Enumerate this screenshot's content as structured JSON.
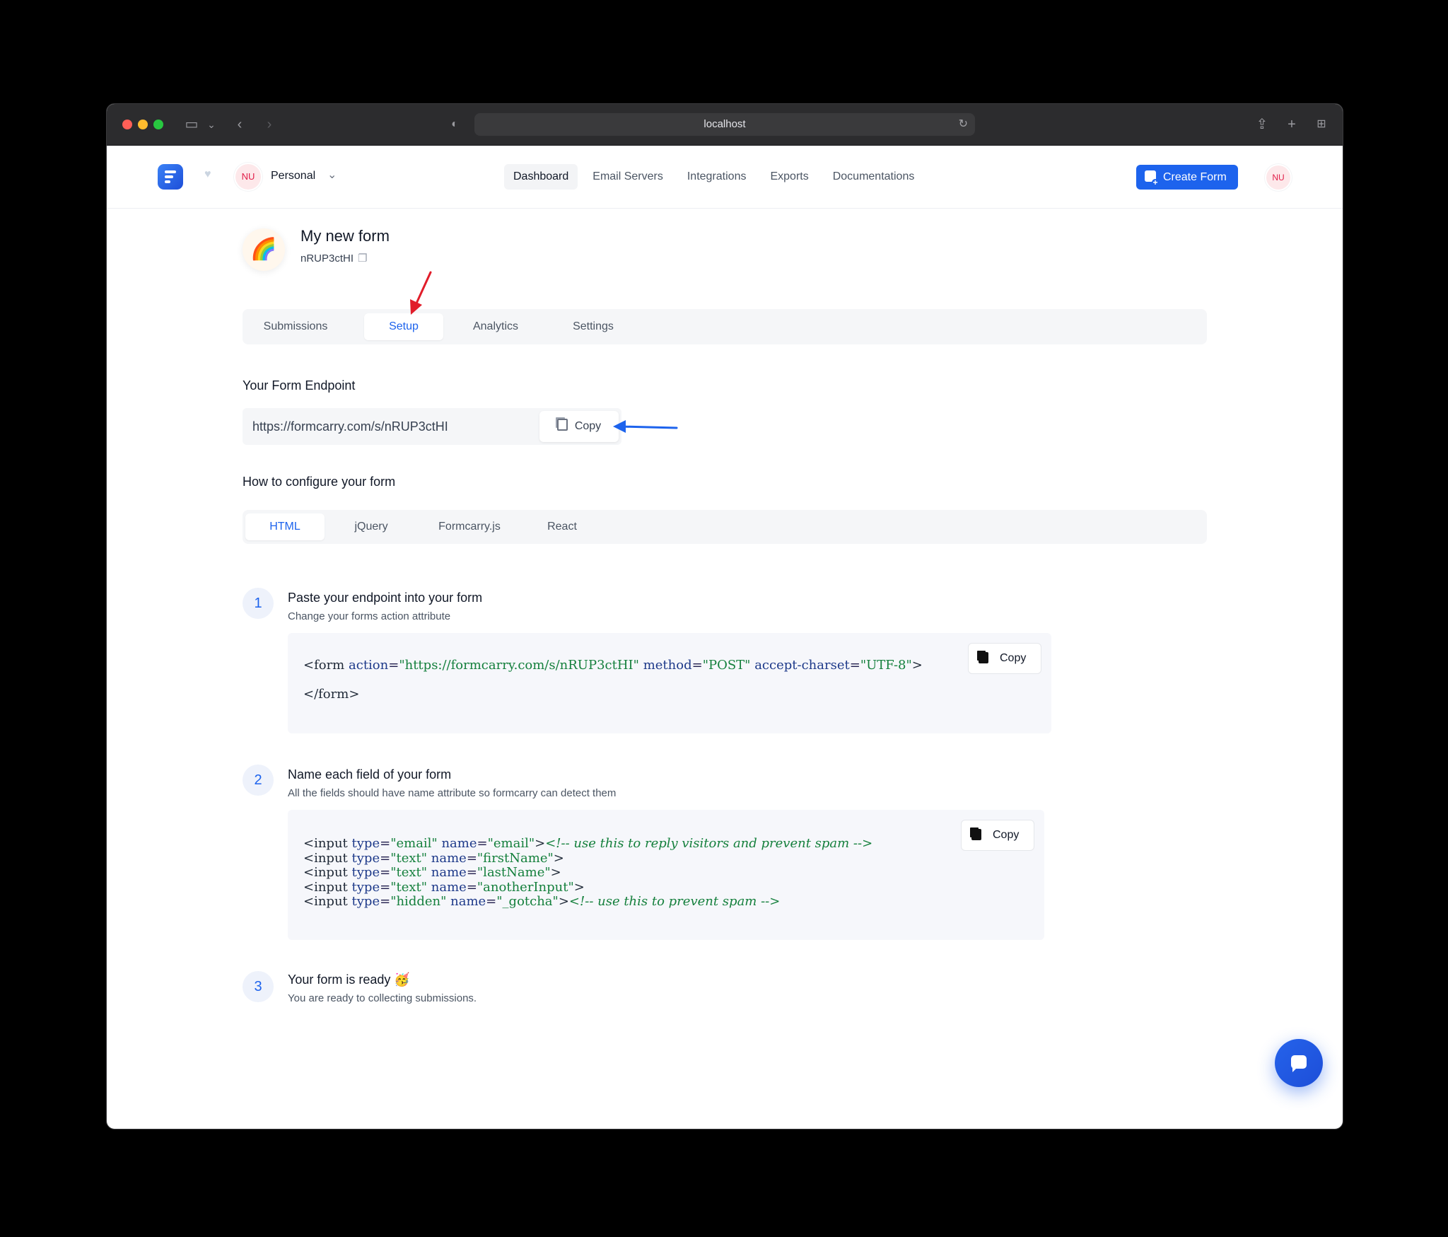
{
  "browser": {
    "url": "localhost"
  },
  "header": {
    "workspace_initials": "NU",
    "workspace_name": "Personal",
    "nav": [
      "Dashboard",
      "Email Servers",
      "Integrations",
      "Exports",
      "Documentations"
    ],
    "active_nav": "Dashboard",
    "create_button": "Create Form",
    "user_initials": "NU"
  },
  "form": {
    "icon": "🌈",
    "title": "My new form",
    "id": "nRUP3ctHI"
  },
  "tabs": [
    "Submissions",
    "Setup",
    "Analytics",
    "Settings"
  ],
  "active_tab": "Setup",
  "endpoint": {
    "heading": "Your Form Endpoint",
    "value": "https://formcarry.com/s/nRUP3ctHI",
    "copy_label": "Copy"
  },
  "configure": {
    "heading": "How to configure your form",
    "tabs": [
      "HTML",
      "jQuery",
      "Formcarry.js",
      "React"
    ],
    "active_tab": "HTML"
  },
  "steps": [
    {
      "number": "1",
      "title": "Paste your endpoint into your form",
      "subtitle": "Change your forms action attribute",
      "copy_label": "Copy",
      "code": {
        "l1_tag": "<form",
        "l1_a1": "action",
        "l1_v1": "\"https://formcarry.com/s/nRUP3ctHI\"",
        "l1_a2": "method",
        "l1_v2": "\"POST\"",
        "l1_a3": "accept-charset",
        "l1_v3": "\"UTF-8\"",
        "l1_end": ">",
        "l2": "</form>"
      }
    },
    {
      "number": "2",
      "title": "Name each field of your form",
      "subtitle": "All the fields should have name attribute so formcarry can detect them",
      "copy_label": "Copy",
      "lines": [
        {
          "type": "\"email\"",
          "name": "\"email\"",
          "comment": "<!-- use this to reply visitors and prevent spam -->"
        },
        {
          "type": "\"text\"",
          "name": "\"firstName\"",
          "comment": ""
        },
        {
          "type": "\"text\"",
          "name": "\"lastName\"",
          "comment": ""
        },
        {
          "type": "\"text\"",
          "name": "\"anotherInput\"",
          "comment": ""
        },
        {
          "type": "\"hidden\"",
          "name": "\"_gotcha\"",
          "comment": "<!-- use this to prevent spam -->"
        }
      ]
    },
    {
      "number": "3",
      "title": "Your form is ready 🥳",
      "subtitle": "You are ready to collecting submissions."
    }
  ],
  "colors": {
    "accent": "#1d63ed",
    "annotation_red": "#e11d2a",
    "annotation_blue": "#1d63ed"
  }
}
